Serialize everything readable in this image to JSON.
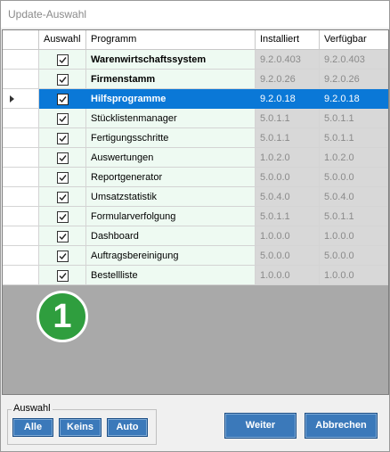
{
  "window": {
    "title": "Update-Auswahl"
  },
  "grid": {
    "columns": [
      "",
      "Auswahl",
      "Programm",
      "Installiert",
      "Verfügbar"
    ],
    "rows": [
      {
        "checked": true,
        "program": "Warenwirtschaftssystem",
        "installed": "9.2.0.403",
        "available": "9.2.0.403",
        "bold": true
      },
      {
        "checked": true,
        "program": "Firmenstamm",
        "installed": "9.2.0.26",
        "available": "9.2.0.26",
        "bold": true
      },
      {
        "checked": true,
        "program": "Hilfsprogramme",
        "installed": "9.2.0.18",
        "available": "9.2.0.18",
        "bold": true,
        "selected": true
      },
      {
        "checked": true,
        "program": "Stücklistenmanager",
        "installed": "5.0.1.1",
        "available": "5.0.1.1"
      },
      {
        "checked": true,
        "program": "Fertigungsschritte",
        "installed": "5.0.1.1",
        "available": "5.0.1.1"
      },
      {
        "checked": true,
        "program": "Auswertungen",
        "installed": "1.0.2.0",
        "available": "1.0.2.0"
      },
      {
        "checked": true,
        "program": "Reportgenerator",
        "installed": "5.0.0.0",
        "available": "5.0.0.0"
      },
      {
        "checked": true,
        "program": "Umsatzstatistik",
        "installed": "5.0.4.0",
        "available": "5.0.4.0"
      },
      {
        "checked": true,
        "program": "Formularverfolgung",
        "installed": "5.0.1.1",
        "available": "5.0.1.1"
      },
      {
        "checked": true,
        "program": "Dashboard",
        "installed": "1.0.0.0",
        "available": "1.0.0.0"
      },
      {
        "checked": true,
        "program": "Auftragsbereinigung",
        "installed": "5.0.0.0",
        "available": "5.0.0.0"
      },
      {
        "checked": true,
        "program": "Bestellliste",
        "installed": "1.0.0.0",
        "available": "1.0.0.0"
      }
    ]
  },
  "badge": {
    "number": "1"
  },
  "selection_group": {
    "label": "Auswahl",
    "all": "Alle",
    "none": "Keins",
    "auto": "Auto"
  },
  "actions": {
    "next": "Weiter",
    "cancel": "Abbrechen"
  },
  "colors": {
    "selected_row": "#0a78d7",
    "button": "#3b79ba",
    "badge": "#2f9e3e"
  }
}
